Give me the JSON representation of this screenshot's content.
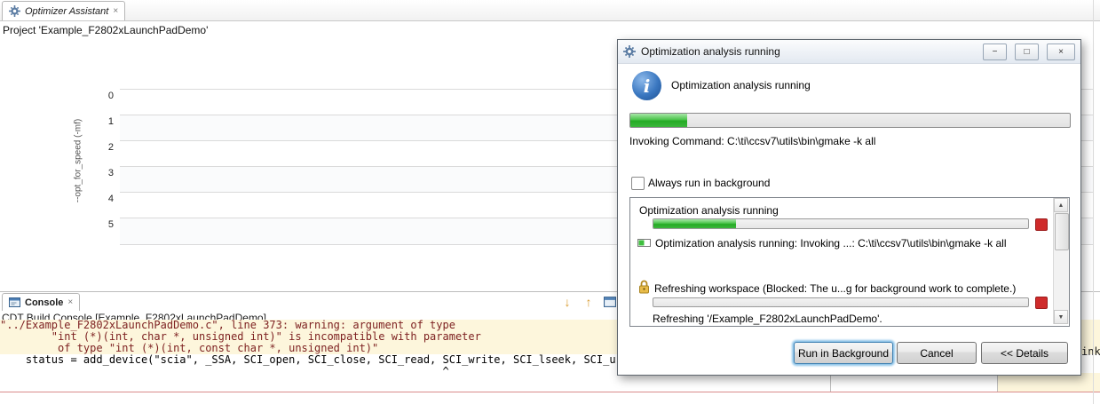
{
  "colors": {
    "progress_green": "#2fb32f",
    "terminate_red": "#cf2b2b",
    "console_highlight": "#fdf6dc",
    "focus_blue": "#3c7fb1"
  },
  "editor": {
    "tab_label": "Optimizer Assistant",
    "project_label": "Project 'Example_F2802xLaunchPadDemo'",
    "chart": {
      "ylabel": "--opt_for_speed (-mf)",
      "ticks": [
        "0",
        "1",
        "2",
        "3",
        "4",
        "5"
      ]
    }
  },
  "console": {
    "tab_label": "Console",
    "title": "CDT Build Console [Example_F2802xLaunchPadDemo]",
    "lines": [
      "\"../Example_F2802xLaunchPadDemo.c\", line 373: warning: argument of type",
      "        \"int (*)(int, char *, unsigned int)\" is incompatible with parameter",
      "         of type \"int (*)(int, const char *, unsigned int)\"",
      "    status = add_device(\"scia\", _SSA, SCI_open, SCI_close, SCI_read, SCI_write, SCI_lseek, SCI_u",
      "                                                                     ^"
    ],
    "clipped_fragment": "ink"
  },
  "dialog": {
    "title": "Optimization analysis running",
    "heading": "Optimization analysis running",
    "main_progress_percent": 13,
    "invoking_text": "Invoking Command: C:\\ti\\ccsv7\\utils\\bin\\gmake -k all",
    "background_checkbox_label": "Always run in background",
    "window_buttons": {
      "minimize": "−",
      "restore": "□",
      "close": "×"
    },
    "jobs": [
      {
        "label": "Optimization analysis running",
        "progress_percent": 22
      },
      {
        "label": "Optimization analysis running: Invoking ...: C:\\ti\\ccsv7\\utils\\bin\\gmake -k all"
      },
      {
        "label": "Refreshing workspace (Blocked: The u...g for background work to complete.)",
        "progress_percent": 0
      },
      {
        "label": "Refreshing '/Example_F2802xLaunchPadDemo'."
      }
    ],
    "buttons": {
      "run_in_background": "Run in Background",
      "cancel": "Cancel",
      "details": "<< Details"
    }
  }
}
